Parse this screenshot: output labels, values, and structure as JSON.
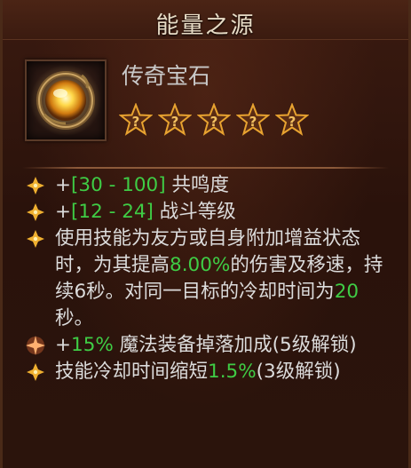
{
  "tooltip": {
    "title": "能量之源",
    "item_type": "传奇宝石",
    "stars": [
      "?",
      "?",
      "?",
      "?",
      "?"
    ],
    "gem_icon": "legendary-gem-icon",
    "properties": [
      {
        "bullet": "diamond",
        "parts": [
          "+",
          "[30 - 100]",
          " 共鸣度"
        ]
      },
      {
        "bullet": "diamond",
        "parts": [
          "+",
          "[12 - 24]",
          " 战斗等级"
        ]
      },
      {
        "bullet": "diamond",
        "parts": [
          "使用技能为友方或自身附加增益状态时，为其提高",
          "8.00%",
          "的伤害及移速，持续6秒。对同一目标的冷却时间为",
          "20",
          "秒。"
        ]
      },
      {
        "bullet": "burst",
        "parts": [
          "+",
          "15%",
          " 魔法装备掉落加成(5级解锁)"
        ]
      },
      {
        "bullet": "diamond",
        "parts": [
          "技能冷却时间缩短",
          "1.5%",
          "(3级解锁)"
        ]
      }
    ],
    "colors": {
      "highlight": "#3fcc45",
      "text": "#dcdcdc",
      "star_gold": "#e8a330",
      "bullet_gold": "#f0b030"
    }
  }
}
